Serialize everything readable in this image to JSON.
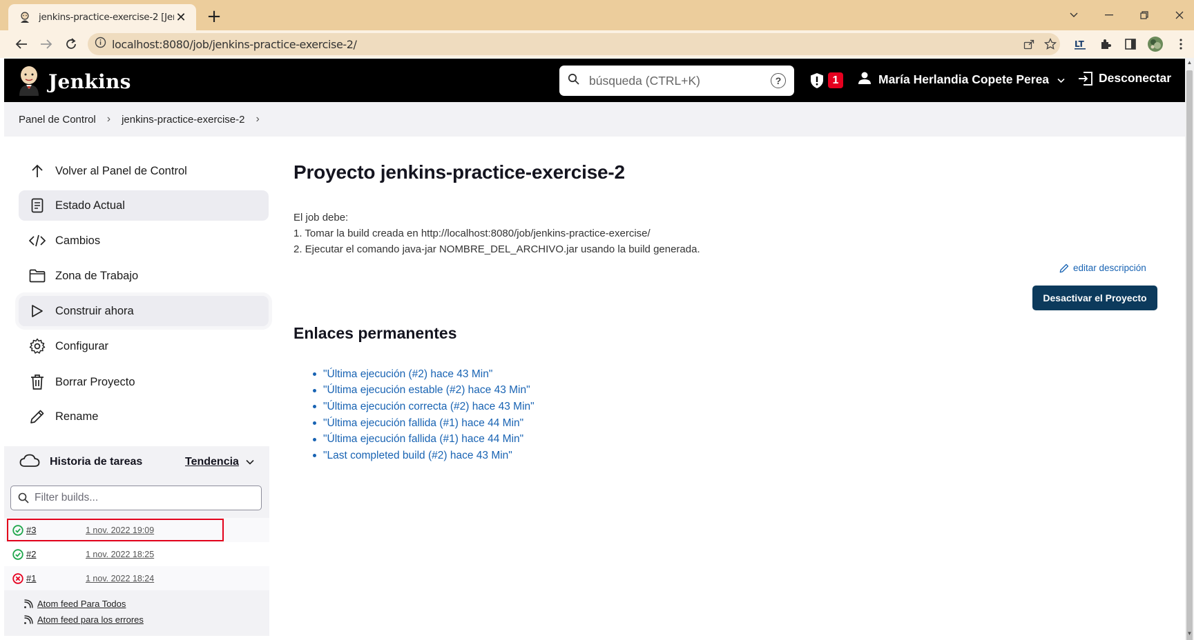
{
  "browser": {
    "tab_title": "jenkins-practice-exercise-2 [Jenkins]",
    "url": "localhost:8080/job/jenkins-practice-exercise-2/"
  },
  "header": {
    "brand": "Jenkins",
    "search_placeholder": "búsqueda (CTRL+K)",
    "alert_count": "1",
    "user_name": "María Herlandia Copete Perea",
    "logout_label": "Desconectar"
  },
  "breadcrumb": {
    "items": [
      "Panel de Control",
      "jenkins-practice-exercise-2"
    ]
  },
  "sidebar": {
    "items": [
      {
        "label": "Volver al Panel de Control",
        "icon": "arrow-up-icon"
      },
      {
        "label": "Estado Actual",
        "icon": "document-icon"
      },
      {
        "label": "Cambios",
        "icon": "code-icon"
      },
      {
        "label": "Zona de Trabajo",
        "icon": "folder-icon"
      },
      {
        "label": "Construir ahora",
        "icon": "play-icon"
      },
      {
        "label": "Configurar",
        "icon": "gear-icon"
      },
      {
        "label": "Borrar Proyecto",
        "icon": "trash-icon"
      },
      {
        "label": "Rename",
        "icon": "pencil-icon"
      }
    ]
  },
  "history": {
    "title": "Historia de tareas",
    "trend_label": "Tendencia",
    "filter_placeholder": "Filter builds...",
    "builds": [
      {
        "number": "#3",
        "date": "1 nov. 2022 19:09",
        "status": "success"
      },
      {
        "number": "#2",
        "date": "1 nov. 2022 18:25",
        "status": "success"
      },
      {
        "number": "#1",
        "date": "1 nov. 2022 18:24",
        "status": "failed"
      }
    ],
    "feeds": [
      "Atom feed Para Todos",
      "Atom feed para los errores"
    ]
  },
  "main": {
    "title": "Proyecto jenkins-practice-exercise-2",
    "description_lines": [
      "El job debe:",
      "1. Tomar la build creada en http://localhost:8080/job/jenkins-practice-exercise/",
      "2. Ejecutar el comando java-jar NOMBRE_DEL_ARCHIVO.jar usando la build generada."
    ],
    "edit_description_label": "editar descripción",
    "disable_button_label": "Desactivar el Proyecto",
    "permalinks_title": "Enlaces permanentes",
    "permalinks": [
      "\"Última ejecución (#2) hace 43 Min\"",
      "\"Última ejecución estable (#2) hace 43 Min\"",
      "\"Última ejecución correcta (#2) hace 43 Min\"",
      "\"Última ejecución fallida (#1) hace 44 Min\"",
      "\"Última ejecución fallida (#1) hace 44 Min\"",
      "\"Last completed build (#2) hace 43 Min\""
    ]
  },
  "colors": {
    "tabstrip": "#eccd9c",
    "header": "#000000",
    "link": "#1863b3",
    "primary_button": "#0c3a5c",
    "success": "#1ea64b",
    "failure": "#e6001f",
    "highlight_box": "#e2001a"
  }
}
